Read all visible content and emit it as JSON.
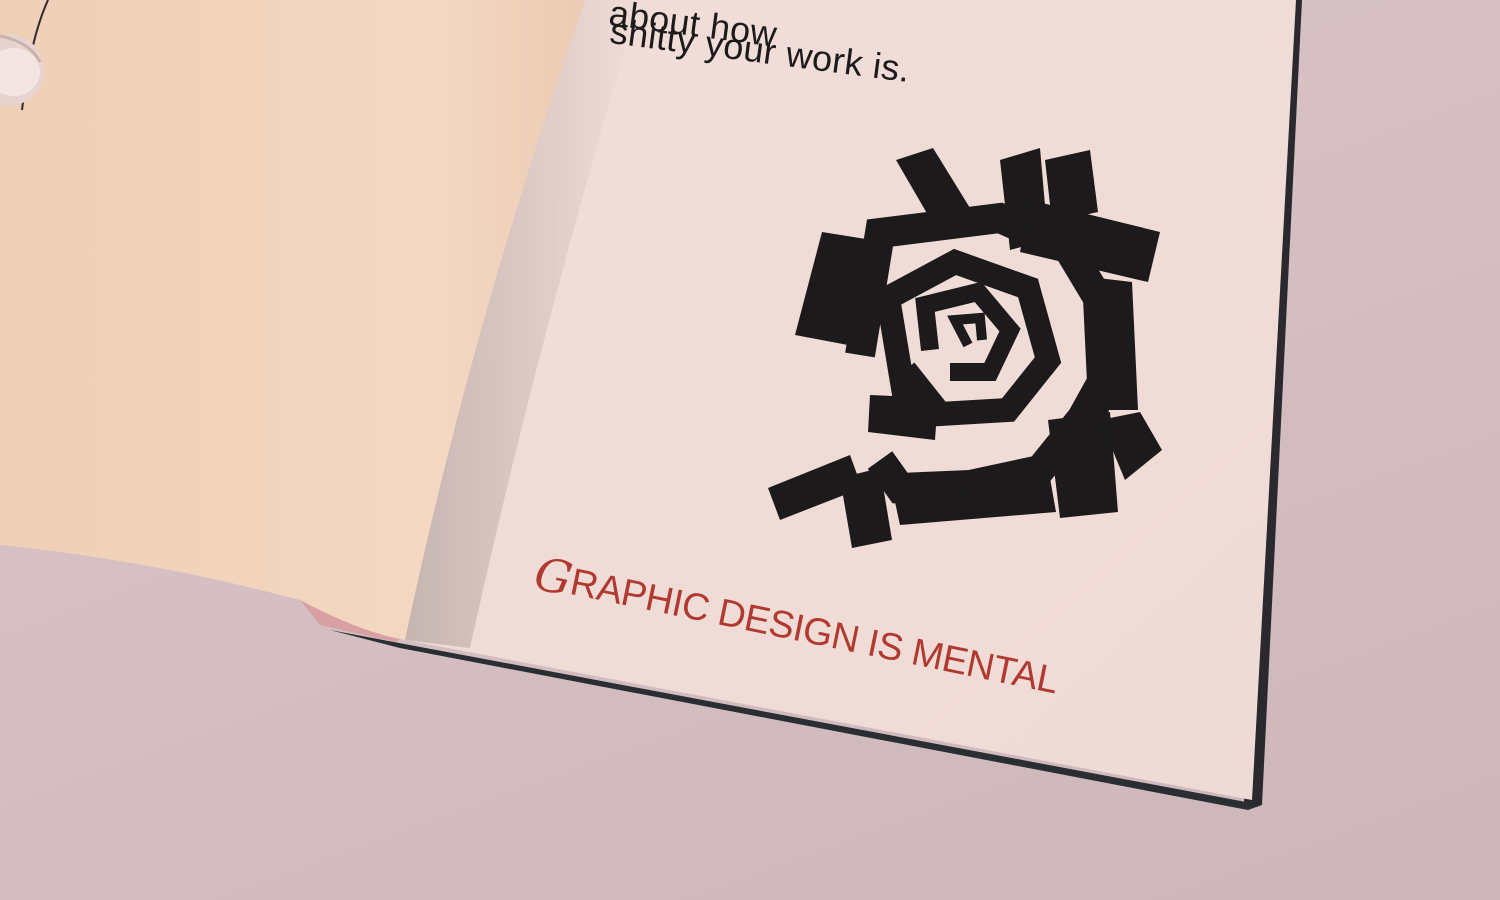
{
  "page_text": {
    "top_line_1": "about how",
    "top_line_2": "shitty your work is.",
    "title_initial": "G",
    "title_rest": "RAPHIC DESIGN IS MENTAL"
  },
  "colors": {
    "background": "#d7c2c4",
    "left_page": "#f3d6bf",
    "right_page": "#f2dedb",
    "ink_black": "#1c1a1a",
    "title_red": "#b03a30"
  },
  "illustration": {
    "icon": "spiral-glyph-icon",
    "description_color": "black"
  }
}
